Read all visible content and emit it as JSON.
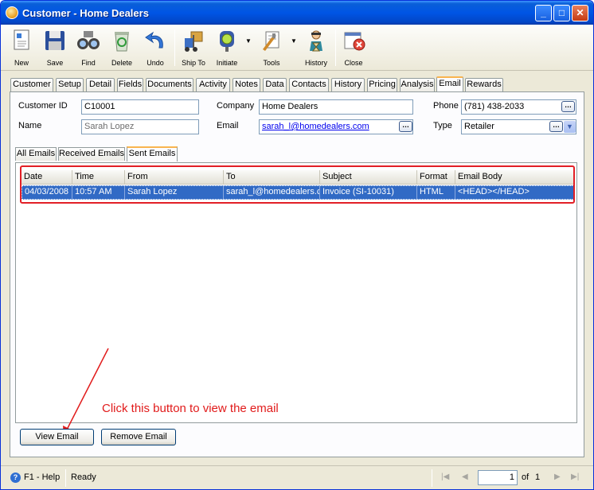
{
  "window": {
    "title": "Customer - Home Dealers"
  },
  "toolbar": {
    "items": [
      {
        "label": "New",
        "icon": "new-document-icon"
      },
      {
        "label": "Save",
        "icon": "floppy-disk-icon"
      },
      {
        "label": "Find",
        "icon": "binoculars-icon"
      },
      {
        "label": "Delete",
        "icon": "recycle-bin-icon"
      },
      {
        "label": "Undo",
        "icon": "undo-arrow-icon"
      },
      {
        "label": "Ship To",
        "icon": "forklift-icon"
      },
      {
        "label": "Initiate",
        "icon": "traffic-light-icon"
      },
      {
        "label": "Tools",
        "icon": "tools-icon"
      },
      {
        "label": "History",
        "icon": "person-hourglass-icon"
      },
      {
        "label": "Close",
        "icon": "close-window-icon"
      }
    ]
  },
  "tabs": [
    "Customer",
    "Setup",
    "Detail",
    "Fields",
    "Documents",
    "Activity",
    "Notes",
    "Data",
    "Contacts",
    "History",
    "Pricing",
    "Analysis",
    "Email",
    "Rewards"
  ],
  "active_tab": "Email",
  "form": {
    "customer_id_label": "Customer ID",
    "customer_id": "C10001",
    "name_label": "Name",
    "name": "Sarah Lopez",
    "company_label": "Company",
    "company": "Home Dealers",
    "email_label": "Email",
    "email": "sarah_l@homedealers.com",
    "phone_label": "Phone",
    "phone": "(781) 438-2033",
    "type_label": "Type",
    "type": "Retailer"
  },
  "email_tabs": [
    "All Emails",
    "Received Emails",
    "Sent Emails"
  ],
  "active_email_tab": "Sent Emails",
  "grid": {
    "columns": [
      "Date",
      "Time",
      "From",
      "To",
      "Subject",
      "Format",
      "Email Body"
    ],
    "rows": [
      [
        "04/03/2008",
        "10:57 AM",
        "Sarah Lopez",
        "sarah_l@homedealers.com",
        "Invoice (SI-10031)",
        "HTML",
        "<HEAD></HEAD>"
      ]
    ]
  },
  "annotation": "Click this button to view the email",
  "buttons": {
    "view_email": "View Email",
    "remove_email": "Remove Email"
  },
  "status": {
    "help": "F1 - Help",
    "state": "Ready",
    "page": "1",
    "of_label": "of",
    "total": "1"
  },
  "colors": {
    "selection": "#316ac5",
    "annotation": "#e11b1b",
    "title_bar": "#0055e5"
  }
}
